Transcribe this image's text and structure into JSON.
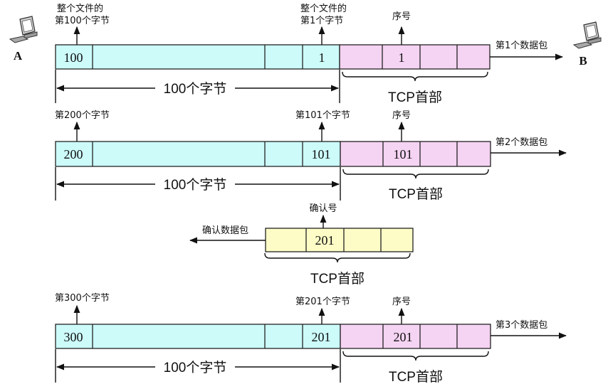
{
  "hosts": {
    "left_label": "A",
    "right_label": "B"
  },
  "colors": {
    "data": "#ccfbfa",
    "tcp_header": "#f5d3f2",
    "ack_header": "#fdfcc6",
    "stroke": "#222222"
  },
  "segments": [
    {
      "first_byte_label": "第100个字节",
      "first_byte_prefix": "整个文件的",
      "first_byte_value": "100",
      "last_byte_label": "第1个字节",
      "last_byte_prefix": "整个文件的",
      "last_byte_value": "1",
      "seq_label": "序号",
      "seq_value": "1",
      "packet_label": "第1个数据包",
      "size_label": "100个字节",
      "header_label": "TCP首部"
    },
    {
      "first_byte_label": "第200个字节",
      "first_byte_prefix": "",
      "first_byte_value": "200",
      "last_byte_label": "第101个字节",
      "last_byte_prefix": "",
      "last_byte_value": "101",
      "seq_label": "序号",
      "seq_value": "101",
      "packet_label": "第2个数据包",
      "size_label": "100个字节",
      "header_label": "TCP首部"
    },
    {
      "first_byte_label": "第300个字节",
      "first_byte_prefix": "",
      "first_byte_value": "300",
      "last_byte_label": "第201个字节",
      "last_byte_prefix": "",
      "last_byte_value": "201",
      "seq_label": "序号",
      "seq_value": "201",
      "packet_label": "第3个数据包",
      "size_label": "100个字节",
      "header_label": "TCP首部"
    }
  ],
  "ack": {
    "ack_field_label": "确认号",
    "ack_value": "201",
    "packet_label": "确认数据包",
    "header_label": "TCP首部"
  }
}
